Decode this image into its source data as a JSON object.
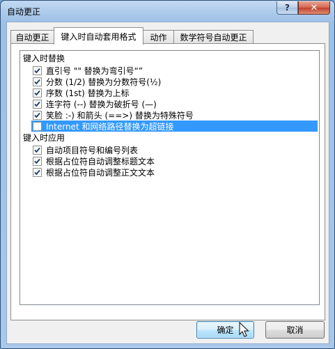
{
  "window": {
    "title": "自动更正",
    "help_label": "?",
    "close_label": "✕"
  },
  "tabs": [
    {
      "label": "自动更正",
      "active": false
    },
    {
      "label": "键入时自动套用格式",
      "active": true
    },
    {
      "label": "动作",
      "active": false
    },
    {
      "label": "数学符号自动更正",
      "active": false
    }
  ],
  "groups": {
    "replace": {
      "label": "键入时替换",
      "items": [
        {
          "label": "直引号 \"\" 替换为弯引号“”",
          "checked": true
        },
        {
          "label": "分数 (1/2) 替换为分数符号(½)",
          "checked": true
        },
        {
          "label": "序数 (1st) 替换为上标",
          "checked": true
        },
        {
          "label": "连字符 (--) 替换为破折号 (—)",
          "checked": true
        },
        {
          "label": "笑脸 :-) 和箭头 (==>) 替换为特殊符号",
          "checked": true
        },
        {
          "label": "Internet 和网络路径替换为超链接",
          "checked": false,
          "selected": true
        }
      ]
    },
    "apply": {
      "label": "键入时应用",
      "items": [
        {
          "label": "自动项目符号和编号列表",
          "checked": true
        },
        {
          "label": "根据占位符自动调整标题文本",
          "checked": true
        },
        {
          "label": "根据占位符自动调整正文文本",
          "checked": true
        }
      ]
    }
  },
  "buttons": {
    "ok_label": "确定",
    "cancel_label": "取消"
  }
}
